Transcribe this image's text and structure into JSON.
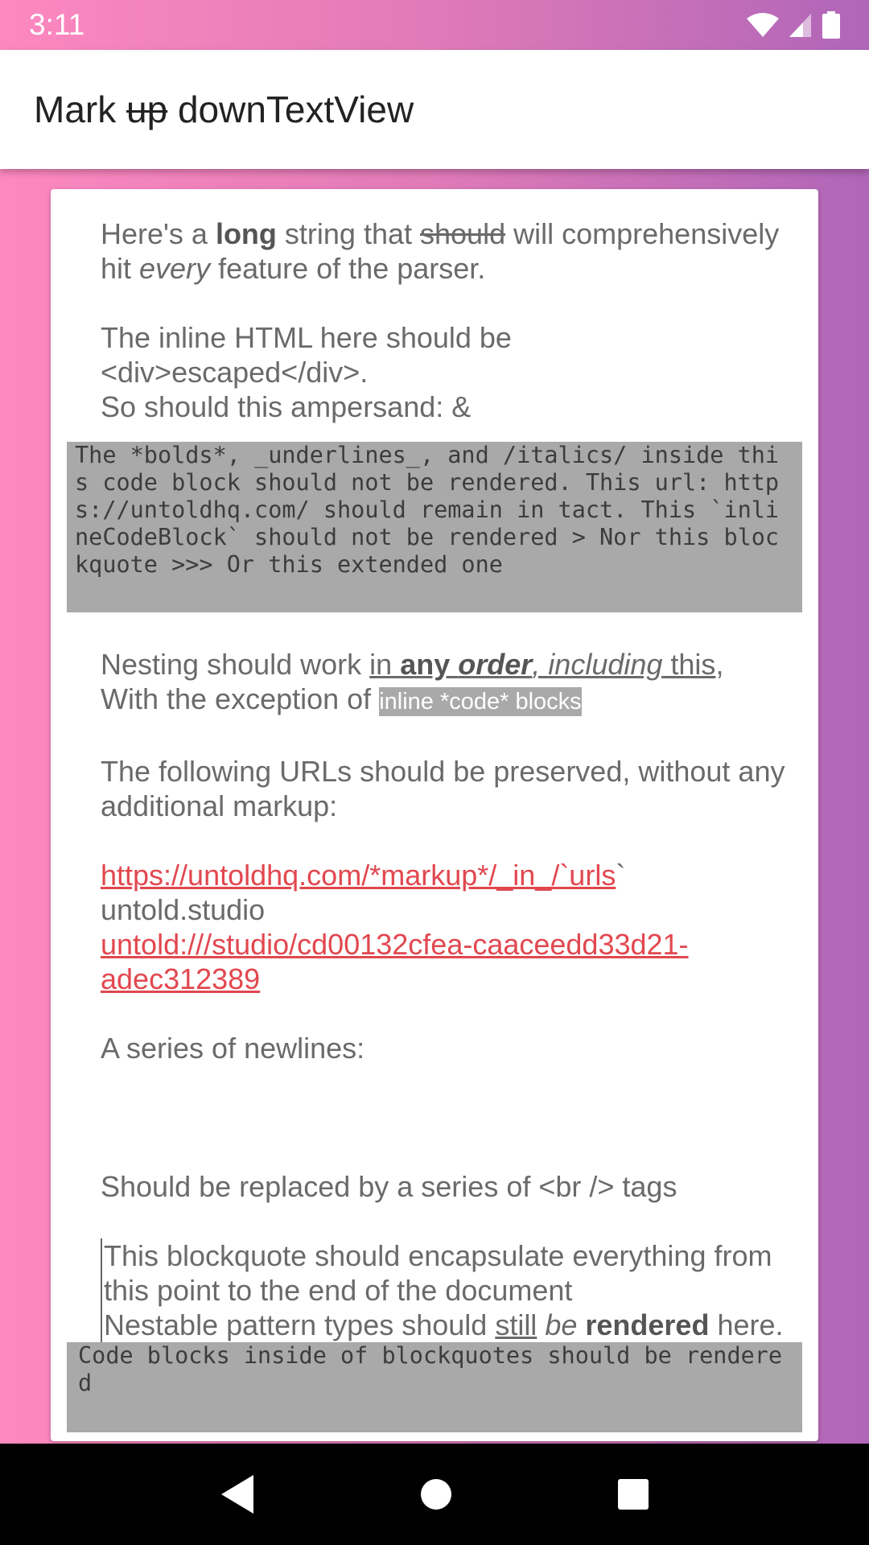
{
  "status_bar": {
    "time": "3:11"
  },
  "app_bar": {
    "title_before": "Mark ",
    "title_struck": "up",
    "title_after": " downTextView"
  },
  "content": {
    "p1": {
      "a": "Here's a ",
      "long": "long",
      "b": " string that ",
      "should": "should",
      "c": " will comprehensively hit ",
      "every": "every",
      "d": " feature of the parser."
    },
    "p2": {
      "line1": "The inline HTML here should be <div>escaped</div>.",
      "line2": "So should this ampersand: &"
    },
    "code_block_1": "The *bolds*, _underlines_, and /italics/ inside this code block should not be rendered. This url: https://untoldhq.com/ should remain in tact. This `inlineCodeBlock` should not be rendered > Nor this blockquote >>> Or this extended one",
    "p3": {
      "a": "Nesting should work ",
      "in": "in ",
      "any": "any ",
      "order": "order",
      "comma": ", ",
      "including": "including",
      "this": " this",
      "b": ", With the exception of ",
      "inline_code": "inline *code* blocks"
    },
    "p4": "The following URLs should be preserved, without any additional markup:",
    "urls": {
      "url1": "https://untoldhq.com/*markup*/_in_/`urls",
      "url1_suffix": "`",
      "url2": "untold.studio",
      "url3_line1": "untold:///studio/cd00132cfea-caaceedd33d21-",
      "url3_line2": "adec312389"
    },
    "p5": "A series of newlines:",
    "p6": "Should be replaced by a series of <br /> tags",
    "quote": {
      "line1": "This blockquote should encapsulate everything from this point to the end of the document",
      "a": "Nestable pattern types should ",
      "still": "still",
      "sp": " ",
      "be": "be",
      "sp2": " ",
      "rendered": "rendered",
      "b": " here.",
      "code_block": "Code blocks inside of blockquotes should be rendered"
    }
  },
  "colors": {
    "accent_link": "#e2474f",
    "code_bg": "#a9a9a9",
    "gradient_start": "#fd88bf",
    "gradient_end": "#b066b8"
  }
}
